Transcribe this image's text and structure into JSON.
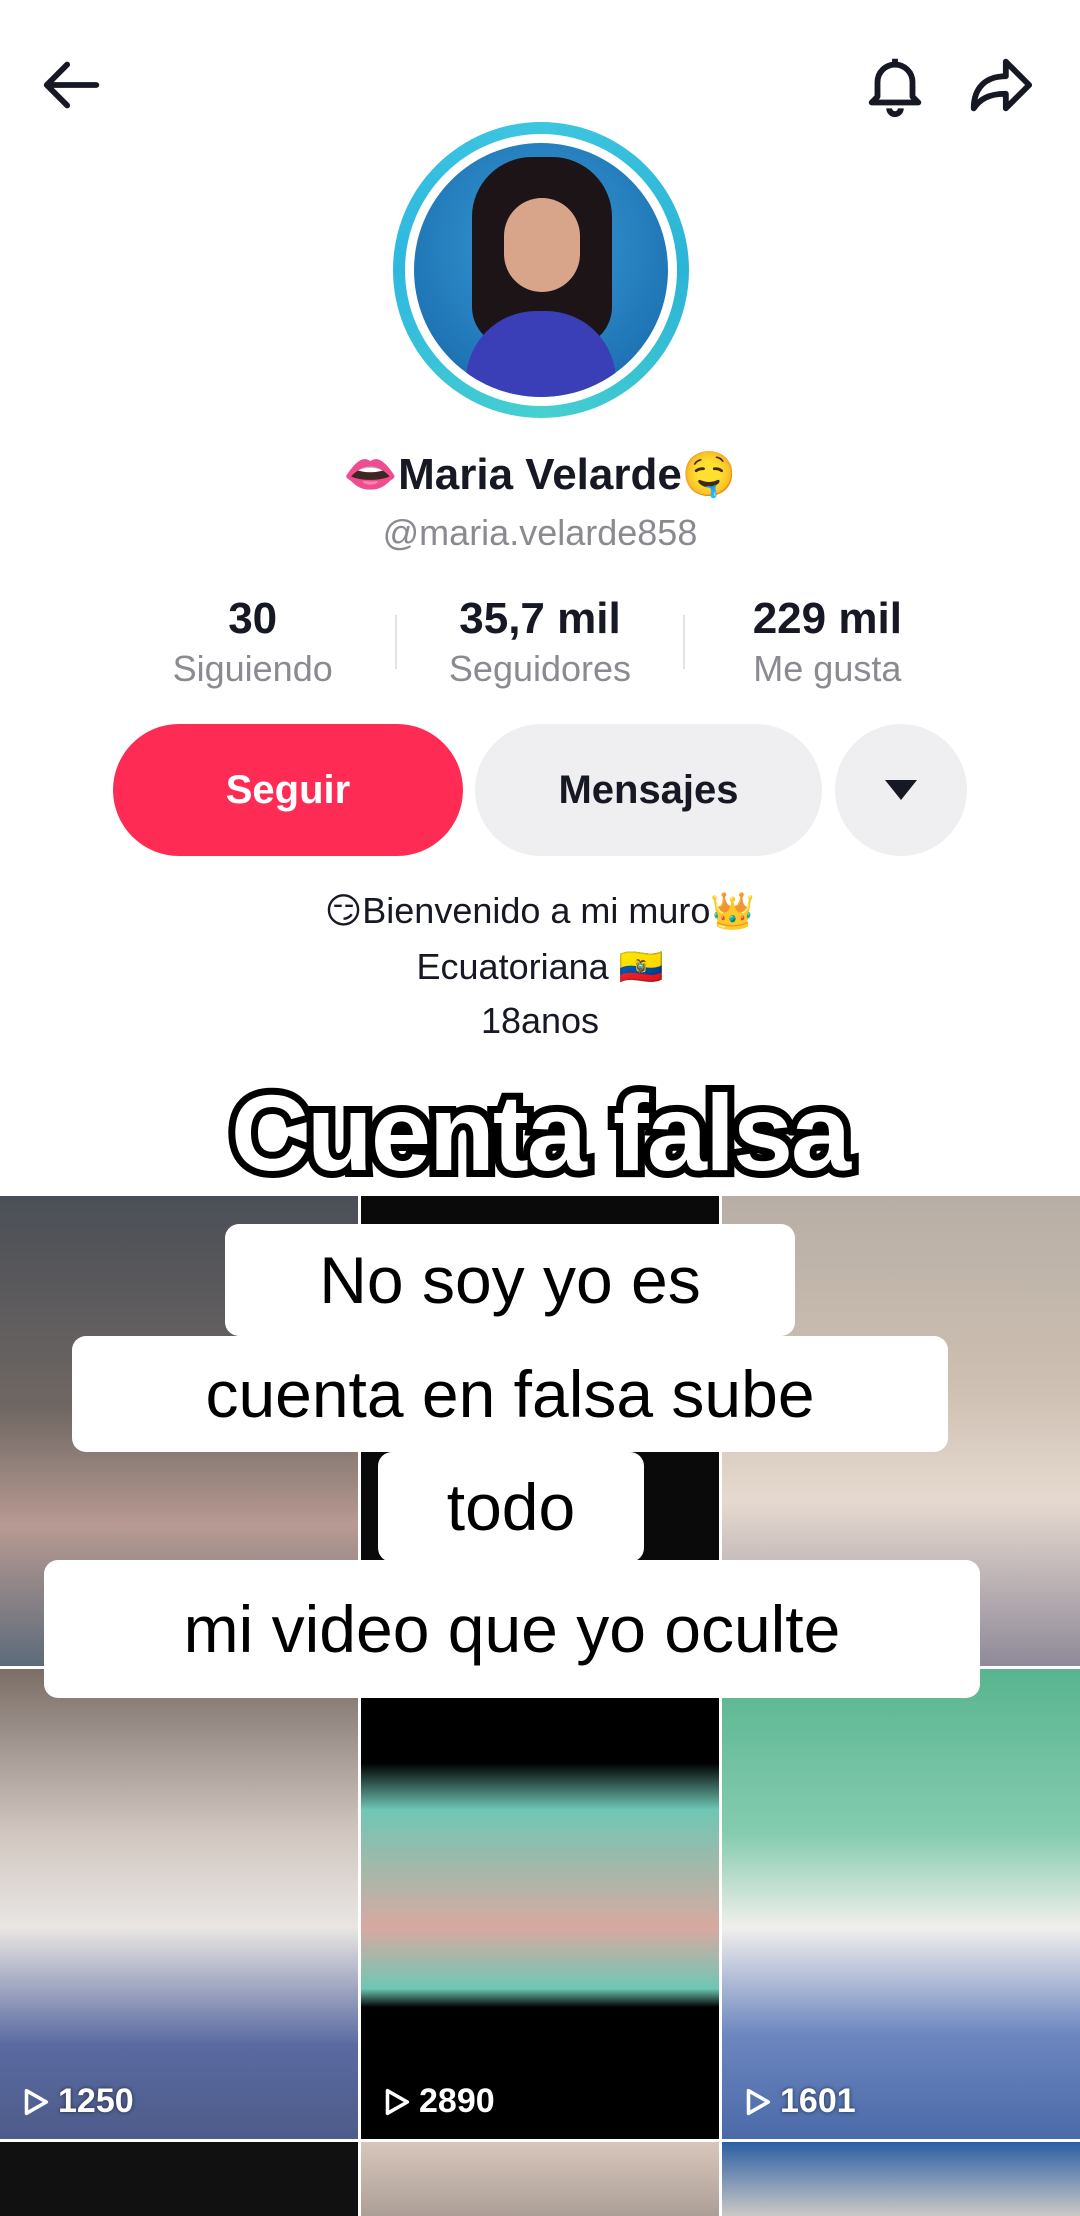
{
  "header": {
    "back_icon": "arrow-left-icon",
    "notifications_icon": "bell-icon",
    "share_icon": "share-arrow-icon"
  },
  "profile": {
    "display_name": "👄Maria Velarde🤤",
    "handle": "@maria.velarde858"
  },
  "stats": [
    {
      "value": "30",
      "label": "Siguiendo"
    },
    {
      "value": "35,7 mil",
      "label": "Seguidores"
    },
    {
      "value": "229 mil",
      "label": "Me gusta"
    }
  ],
  "actions": {
    "follow_label": "Seguir",
    "messages_label": "Mensajes",
    "more_icon": "caret-down-icon"
  },
  "bio": {
    "line1": "😏Bienvenido a mi muro👑",
    "line2": "Ecuatoriana 🇪🇨",
    "line3": "18anos"
  },
  "overlay": {
    "title": "Cuenta falsa",
    "caption_line1": "No soy yo es",
    "caption_line2": "cuenta en falsa sube",
    "caption_line3": "todo",
    "caption_line4": "mi video que yo oculte"
  },
  "videos": [
    {
      "views": ""
    },
    {
      "views": ""
    },
    {
      "views": ""
    },
    {
      "views": "1250"
    },
    {
      "views": "2890"
    },
    {
      "views": "1601"
    }
  ],
  "colors": {
    "follow_button": "#fe2c55",
    "secondary_button": "#efeff1",
    "avatar_ring": "#3ec6e0"
  }
}
